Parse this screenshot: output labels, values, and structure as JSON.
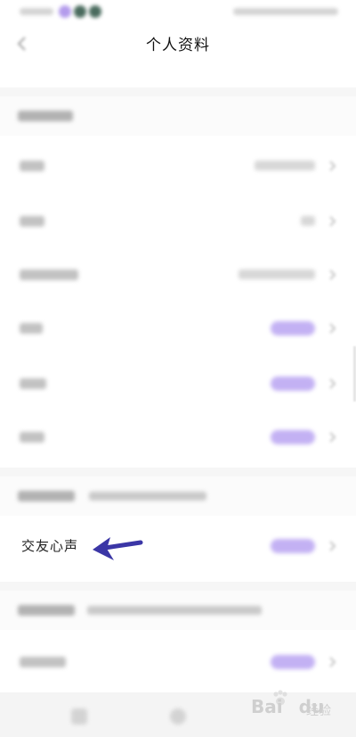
{
  "header": {
    "title": "个人资料"
  },
  "highlight_row": {
    "label": "交友心声"
  },
  "watermark": {
    "main": "Bai",
    "sub": "经验",
    "mid": "du"
  },
  "colors": {
    "accent_pill": "#b9a4f2",
    "arrow": "#3b36a6"
  },
  "icons": {
    "back": "back-arrow-icon",
    "chevron": "chevron-right-icon",
    "annotation": "pointing-arrow-icon"
  }
}
